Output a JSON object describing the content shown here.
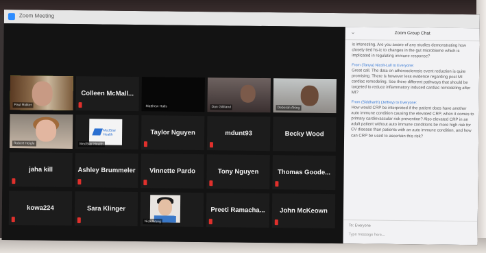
{
  "window": {
    "title": "Zoom Meeting"
  },
  "chat": {
    "title": "Zoom Group Chat",
    "intro": "is interesting. Are you aware of any studies demonstrating how closely tied hs-ic to changes in the gut microbiome which is implicated in regulating immune response?",
    "messages": [
      {
        "meta": "From (Tanya) Nicolt-Lull to Everyone:",
        "text": "Great call. The data on atherosclerosis event reduction is quite promising. There is however less evidence regarding post MI cardiac remodeling. See there different pathways that should be targeted to reduce inflammatory induced cardiac remodeling after MI?"
      },
      {
        "meta": "From (Siddharth) (Jeffrey) to Everyone:",
        "text": "How would CRP be interpreted if the patient does have another auto immune condition causing the elevated CRP, when it comes to primary cardiovascular risk prevention? Also elevated CRP in an adult patient without auto immune conditions be more high risk for CV disease than patients with an auto immune condition, and how can CRP be used to ascertain this risk?"
      }
    ],
    "to_label": "To: Everyone",
    "input_placeholder": "Type message here..."
  },
  "participants": [
    {
      "name": "",
      "tag": "Paul Ridker",
      "mic": false,
      "kind": "cam1",
      "active": true
    },
    {
      "name": "Colleen McMall...",
      "tag": "",
      "mic": true,
      "kind": "name"
    },
    {
      "name": "",
      "tag": "Matthew Halls",
      "mic": true,
      "kind": "blank"
    },
    {
      "name": "",
      "tag": "Dan Gilliland",
      "mic": true,
      "kind": "cam3"
    },
    {
      "name": "",
      "tag": "Deborah Aking",
      "mic": false,
      "kind": "cam4"
    },
    {
      "name": "",
      "tag": "Robert Heigle",
      "mic": true,
      "kind": "cam5"
    },
    {
      "name": "",
      "tag": "MedStar Health",
      "mic": true,
      "kind": "logo",
      "logo_text": "MedStar Health"
    },
    {
      "name": "Taylor Nguyen",
      "tag": "",
      "mic": true,
      "kind": "name"
    },
    {
      "name": "mdunt93",
      "tag": "",
      "mic": true,
      "kind": "name"
    },
    {
      "name": "Becky Wood",
      "tag": "",
      "mic": false,
      "kind": "name"
    },
    {
      "name": "jaha kill",
      "tag": "",
      "mic": true,
      "kind": "name"
    },
    {
      "name": "Ashley Brummeler",
      "tag": "",
      "mic": true,
      "kind": "name"
    },
    {
      "name": "Vinnette Pardo",
      "tag": "",
      "mic": true,
      "kind": "name"
    },
    {
      "name": "Tony Nguyen",
      "tag": "",
      "mic": true,
      "kind": "name"
    },
    {
      "name": "Thomas Goode...",
      "tag": "",
      "mic": true,
      "kind": "name"
    },
    {
      "name": "kowa224",
      "tag": "",
      "mic": true,
      "kind": "name"
    },
    {
      "name": "Sara Klinger",
      "tag": "",
      "mic": true,
      "kind": "name"
    },
    {
      "name": "",
      "tag": "Nick Wong",
      "mic": true,
      "kind": "portrait"
    },
    {
      "name": "Preeti Ramacha...",
      "tag": "",
      "mic": true,
      "kind": "name"
    },
    {
      "name": "John McKeown",
      "tag": "",
      "mic": true,
      "kind": "name"
    }
  ]
}
